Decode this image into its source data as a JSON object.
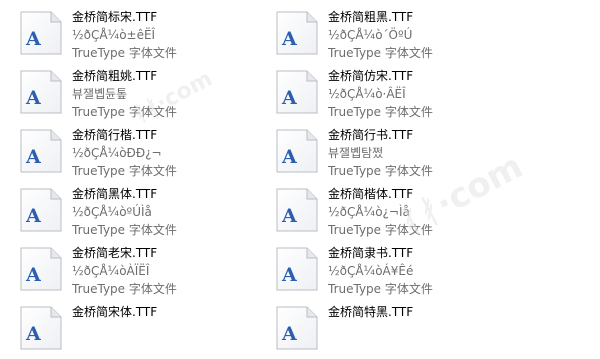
{
  "files": {
    "type_label": "TrueType 字体文件",
    "left": [
      {
        "name": "金桥简标宋.TTF",
        "subtitle": "½ðÇÅ¼ò±êËÎ"
      },
      {
        "name": "金桥简粗姚.TTF",
        "subtitle": "뷰잴볩듄톺"
      },
      {
        "name": "金桥简行楷.TTF",
        "subtitle": "½ðÇÅ¼òÐÐ¿¬"
      },
      {
        "name": "金桥简黑体.TTF",
        "subtitle": "½ðÇÅ¼òºÚÌå"
      },
      {
        "name": "金桥简老宋.TTF",
        "subtitle": "½ðÇÅ¼òÀÏËÎ"
      },
      {
        "name": "金桥简宋体.TTF",
        "subtitle": ""
      }
    ],
    "right": [
      {
        "name": "金桥简粗黑.TTF",
        "subtitle": "½ðÇÅ¼ò´ÖºÚ"
      },
      {
        "name": "金桥简仿宋.TTF",
        "subtitle": "½ðÇÅ¼ò·ÂËÎ"
      },
      {
        "name": "金桥简行书.TTF",
        "subtitle": "뷰잴볩탐쩠"
      },
      {
        "name": "金桥简楷体.TTF",
        "subtitle": "½ðÇÅ¼ò¿¬Ìå"
      },
      {
        "name": "金桥简隶书.TTF",
        "subtitle": "½ðÇÅ¼òÁ¥Êé"
      },
      {
        "name": "金桥简特黑.TTF",
        "subtitle": ""
      }
    ]
  },
  "watermark": "ᚰᚯ·com",
  "icon_name": "truetype-font-file-icon",
  "colors": {
    "icon_letter": "#2d5fb0",
    "text_primary": "#000000",
    "text_secondary": "#6d6d6d"
  }
}
